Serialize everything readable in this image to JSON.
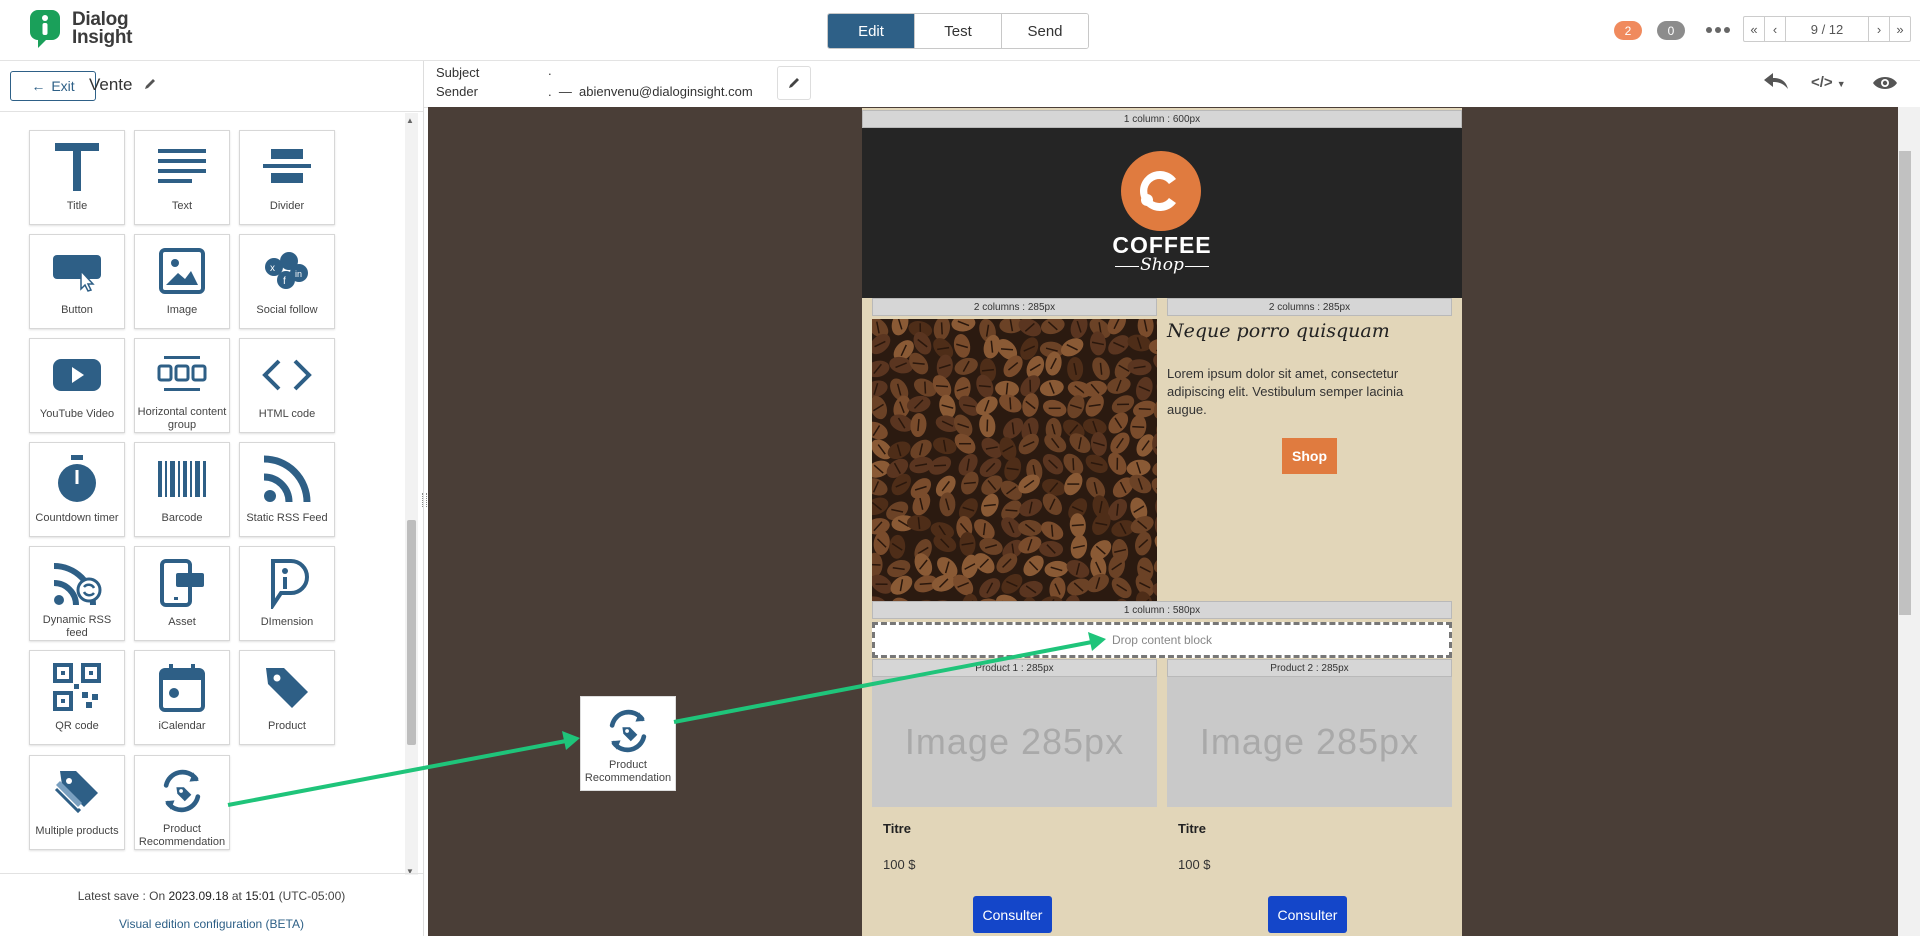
{
  "brand": {
    "line1": "Dialog",
    "line2": "Insight"
  },
  "tabs": [
    {
      "label": "Edit",
      "active": true
    },
    {
      "label": "Test",
      "active": false
    },
    {
      "label": "Send",
      "active": false
    }
  ],
  "badges": {
    "orange": "2",
    "gray": "0"
  },
  "pager": {
    "first": "«",
    "prev": "‹",
    "page": "9 / 12",
    "next": "›",
    "last": "»"
  },
  "panel": {
    "exit_label": "Exit",
    "campaign_name": "Vente",
    "blocks": [
      {
        "label": "Title",
        "icon": "title-icon"
      },
      {
        "label": "Text",
        "icon": "text-icon"
      },
      {
        "label": "Divider",
        "icon": "divider-icon"
      },
      {
        "label": "Button",
        "icon": "button-icon"
      },
      {
        "label": "Image",
        "icon": "image-icon"
      },
      {
        "label": "Social follow",
        "icon": "social-follow-icon"
      },
      {
        "label": "YouTube Video",
        "icon": "youtube-icon"
      },
      {
        "label": "Horizontal content group",
        "icon": "horizontal-group-icon"
      },
      {
        "label": "HTML code",
        "icon": "html-code-icon"
      },
      {
        "label": "Countdown timer",
        "icon": "stopwatch-icon"
      },
      {
        "label": "Barcode",
        "icon": "barcode-icon"
      },
      {
        "label": "Static RSS Feed",
        "icon": "rss-icon"
      },
      {
        "label": "Dynamic RSS feed",
        "icon": "dynamic-rss-icon"
      },
      {
        "label": "Asset",
        "icon": "asset-icon"
      },
      {
        "label": "DImension",
        "icon": "dimension-icon"
      },
      {
        "label": "QR code",
        "icon": "qr-code-icon"
      },
      {
        "label": "iCalendar",
        "icon": "calendar-icon"
      },
      {
        "label": "Product",
        "icon": "product-tag-icon"
      },
      {
        "label": "Multiple products",
        "icon": "multiple-tags-icon"
      },
      {
        "label": "Product Recommendation",
        "icon": "product-recommendation-icon"
      }
    ],
    "save_prefix": "Latest save : On ",
    "save_date": "2023.09.18",
    "save_at": " at ",
    "save_time": "15:01",
    "save_tz": " (UTC-05:00)",
    "config_link": "Visual edition configuration (BETA)"
  },
  "header": {
    "subject_label": "Subject",
    "subject_value": ".",
    "sender_label": "Sender",
    "sender_value": ".  —  abienvenu@dialoginsight.com",
    "code_label": "</>"
  },
  "email": {
    "bar_1col_600": "1 column : 600px",
    "logo_line1": "COFFEE",
    "logo_line2": "Shop",
    "bar_2col_left": "2 columns : 285px",
    "bar_2col_right": "2 columns : 285px",
    "heading": "Neque porro quisquam",
    "body": "Lorem ipsum dolor sit amet, consectetur adipiscing elit. Vestibulum semper lacinia augue.",
    "shop_button": "Shop",
    "bar_1col_580": "1 column : 580px",
    "drop_zone": "Drop content block",
    "product1_bar": "Product 1 : 285px",
    "product2_bar": "Product 2 : 285px",
    "image_placeholder_1": "Image 285px",
    "image_placeholder_2": "Image 285px",
    "title_1": "Titre",
    "title_2": "Titre",
    "price_1": "100 $",
    "price_2": "100 $",
    "consult_1": "Consulter",
    "consult_2": "Consulter"
  },
  "drag_ghost": {
    "label": "Product Recommendation"
  },
  "colors": {
    "accent": "#2e6087",
    "arrow": "#1fc47a",
    "shop": "#e07b3f",
    "consult": "#1446c9",
    "canvas": "#4a3e37"
  }
}
